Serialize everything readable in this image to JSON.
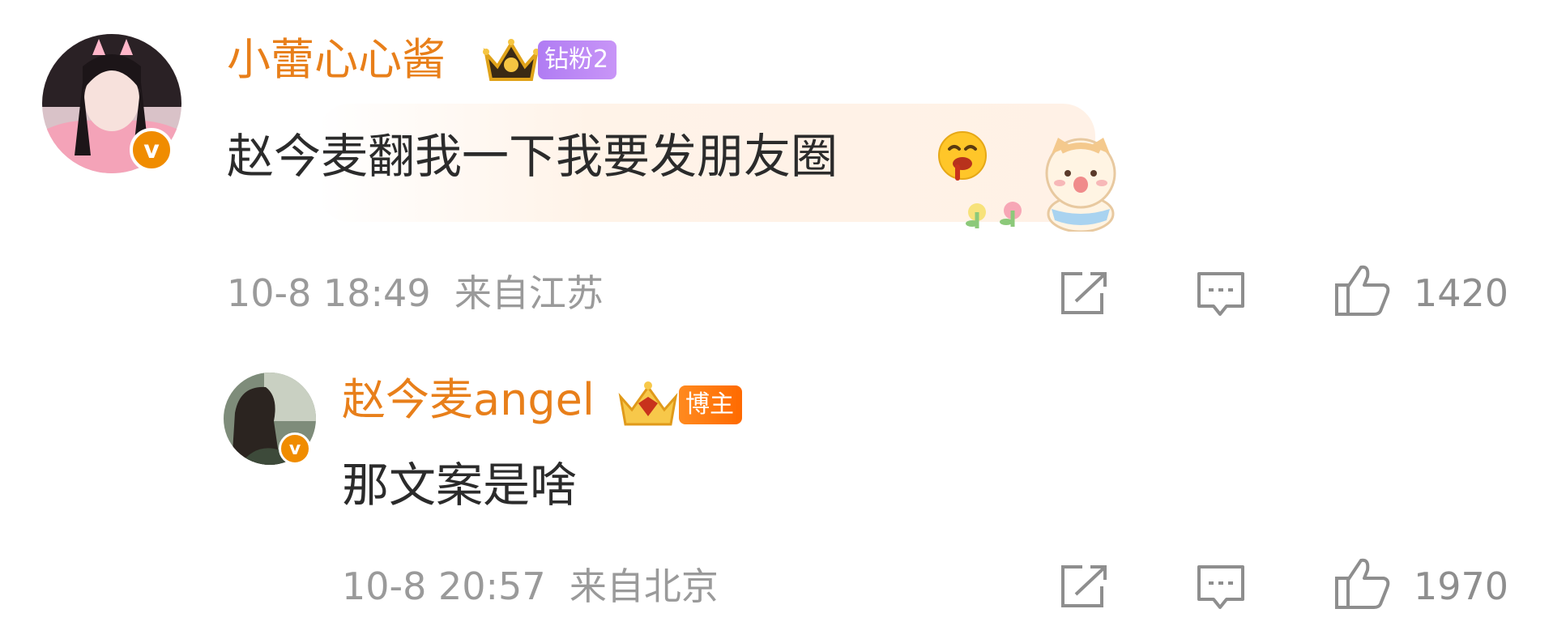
{
  "comments": [
    {
      "username": "小蕾心心酱",
      "badge_label": "钻粉2",
      "text": "赵今麦翻我一下我要发朋友圈",
      "time": "10-8 18:49",
      "location": "来自江苏",
      "likes": "1420",
      "avatar_badge": "v",
      "accent_color": "#e87f1a"
    },
    {
      "username": "赵今麦angel",
      "badge_label": "博主",
      "text": "那文案是啥",
      "time": "10-8 20:57",
      "location": "来自北京",
      "likes": "1970",
      "avatar_badge": "v",
      "accent_color": "#e87f1a"
    }
  ],
  "icons": {
    "share": "share-icon",
    "comment": "comment-icon",
    "like": "thumbs-up-icon",
    "crown": "crown-icon",
    "emoji": "drooling-emoji-icon",
    "sticker": "cat-sticker-icon"
  }
}
